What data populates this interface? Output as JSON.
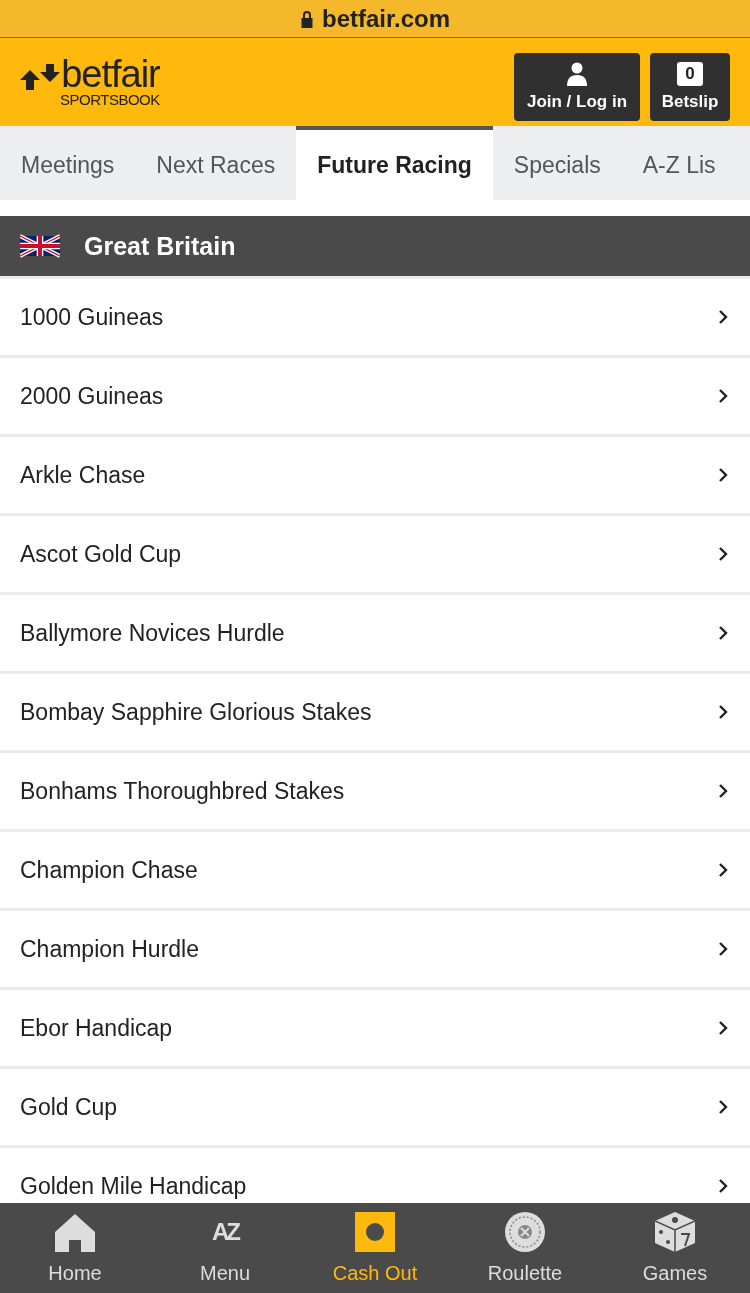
{
  "address_bar": {
    "url": "betfair.com"
  },
  "header": {
    "logo": {
      "name": "betfair",
      "subtitle": "SPORTSBOOK"
    },
    "login_button": "Join / Log in",
    "betslip": {
      "count": "0",
      "label": "Betslip"
    }
  },
  "tabs": [
    {
      "label": "Meetings",
      "selected": false
    },
    {
      "label": "Next Races",
      "selected": false
    },
    {
      "label": "Future Racing",
      "selected": true
    },
    {
      "label": "Specials",
      "selected": false
    },
    {
      "label": "A-Z Lis",
      "selected": false
    }
  ],
  "section": {
    "title": "Great Britain"
  },
  "races": [
    "1000 Guineas",
    "2000 Guineas",
    "Arkle Chase",
    "Ascot Gold Cup",
    "Ballymore Novices Hurdle",
    "Bombay Sapphire Glorious Stakes",
    "Bonhams Thoroughbred Stakes",
    "Champion Chase",
    "Champion Hurdle",
    "Ebor Handicap",
    "Gold Cup",
    "Golden Mile Handicap"
  ],
  "bottom_nav": [
    {
      "kind": "home",
      "label": "Home",
      "selected": false
    },
    {
      "kind": "az",
      "label": "Menu",
      "glyph": "AZ",
      "selected": false
    },
    {
      "kind": "cashout",
      "label": "Cash Out",
      "selected": true
    },
    {
      "kind": "roulette",
      "label": "Roulette",
      "selected": false
    },
    {
      "kind": "games",
      "label": "Games",
      "selected": false
    }
  ]
}
